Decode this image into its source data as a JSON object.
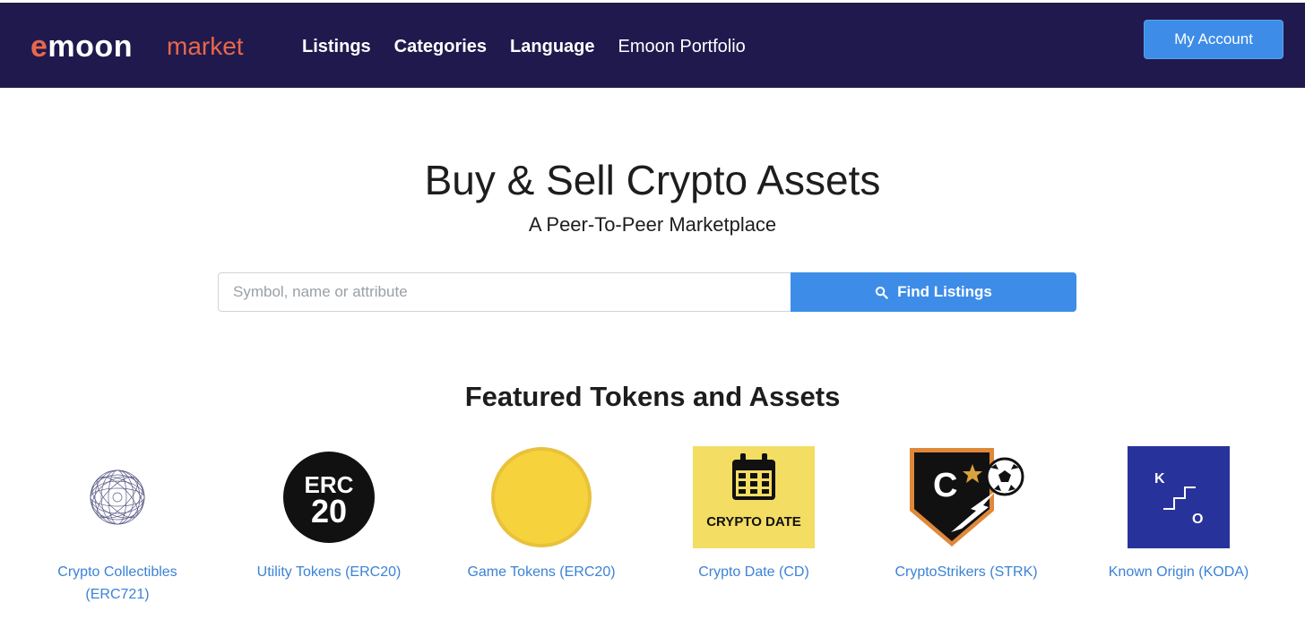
{
  "brand": {
    "logo_main_e": "e",
    "logo_main_rest": "moon",
    "logo_sub": "market"
  },
  "nav": [
    {
      "label": "Listings"
    },
    {
      "label": "Categories"
    },
    {
      "label": "Language"
    },
    {
      "label": "Emoon Portfolio"
    }
  ],
  "account": {
    "label": "My Account"
  },
  "hero": {
    "title": "Buy & Sell Crypto Assets",
    "subtitle": "A Peer-To-Peer Marketplace"
  },
  "search": {
    "placeholder": "Symbol, name or attribute",
    "button_label": "Find Listings",
    "button_icon": "search-icon"
  },
  "featured": {
    "title": "Featured Tokens and Assets",
    "tokens": [
      {
        "label": "Crypto Collectibles (ERC721)",
        "icon": "wire-sphere-icon"
      },
      {
        "label": "Utility Tokens (ERC20)",
        "icon": "erc20-icon",
        "icon_text_top": "ERC",
        "icon_text_bottom": "20"
      },
      {
        "label": "Game Tokens (ERC20)",
        "icon": "gold-coin-icon"
      },
      {
        "label": "Crypto Date (CD)",
        "icon": "calendar-icon",
        "icon_text": "CRYPTO DATE"
      },
      {
        "label": "CryptoStrikers (STRK)",
        "icon": "strikers-shield-icon",
        "icon_text": "C"
      },
      {
        "label": "Known Origin (KODA)",
        "icon": "known-origin-icon",
        "icon_text_k": "K",
        "icon_text_o": "O"
      }
    ]
  },
  "colors": {
    "navbar": "#20194e",
    "accent": "#3d8de8",
    "brand_orange": "#e8674a",
    "link": "#3b82d6"
  }
}
